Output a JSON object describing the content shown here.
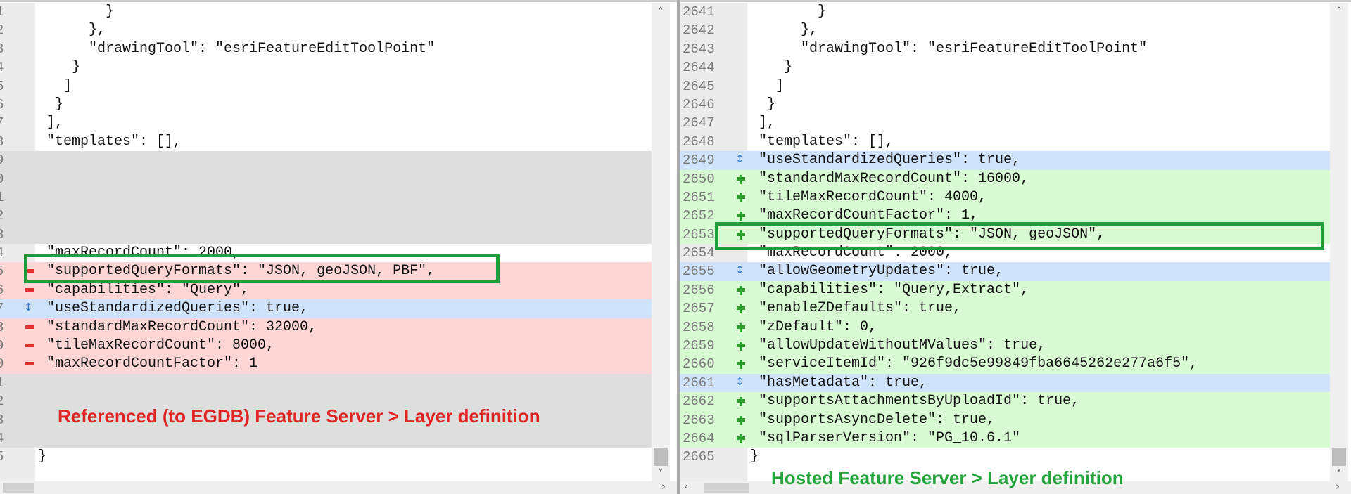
{
  "left_pane": {
    "caption": "Referenced (to EGDB) Feature Server > Layer definition",
    "lines": [
      {
        "num": "1",
        "type": "same",
        "marker": "",
        "text": "        }"
      },
      {
        "num": "2",
        "type": "same",
        "marker": "",
        "text": "      },"
      },
      {
        "num": "3",
        "type": "same",
        "marker": "",
        "text": "      \"drawingTool\": \"esriFeatureEditToolPoint\""
      },
      {
        "num": "4",
        "type": "same",
        "marker": "",
        "text": "    }"
      },
      {
        "num": "5",
        "type": "same",
        "marker": "",
        "text": "   ]"
      },
      {
        "num": "6",
        "type": "same",
        "marker": "",
        "text": "  }"
      },
      {
        "num": "7",
        "type": "same",
        "marker": "",
        "text": " ],"
      },
      {
        "num": "8",
        "type": "same",
        "marker": "",
        "text": " \"templates\": [],"
      },
      {
        "num": "9",
        "type": "gap",
        "marker": "",
        "text": ""
      },
      {
        "num": "0",
        "type": "gap",
        "marker": "",
        "text": ""
      },
      {
        "num": "1",
        "type": "gap",
        "marker": "",
        "text": ""
      },
      {
        "num": "2",
        "type": "gap",
        "marker": "",
        "text": ""
      },
      {
        "num": "3",
        "type": "gap",
        "marker": "",
        "text": ""
      },
      {
        "num": "4",
        "type": "same",
        "marker": "",
        "text": " \"maxRecordCount\": 2000,"
      },
      {
        "num": "5",
        "type": "del",
        "marker": "del",
        "text": " \"supportedQueryFormats\": \"JSON, geoJSON, PBF\","
      },
      {
        "num": "6",
        "type": "del",
        "marker": "del",
        "text": " \"capabilities\": \"Query\","
      },
      {
        "num": "7",
        "type": "chg",
        "marker": "chg",
        "text": " \"useStandardizedQueries\": true,"
      },
      {
        "num": "8",
        "type": "del",
        "marker": "del",
        "text": " \"standardMaxRecordCount\": 32000,"
      },
      {
        "num": "9",
        "type": "del",
        "marker": "del",
        "text": " \"tileMaxRecordCount\": 8000,"
      },
      {
        "num": "0",
        "type": "del",
        "marker": "del",
        "text": " \"maxRecordCountFactor\": 1"
      },
      {
        "num": "1",
        "type": "gap",
        "marker": "",
        "text": ""
      },
      {
        "num": "2",
        "type": "gap",
        "marker": "",
        "text": ""
      },
      {
        "num": "3",
        "type": "gap",
        "marker": "",
        "text": ""
      },
      {
        "num": "4",
        "type": "gap",
        "marker": "",
        "text": ""
      },
      {
        "num": "5",
        "type": "same",
        "marker": "",
        "text": "}"
      }
    ]
  },
  "right_pane": {
    "caption": "Hosted Feature Server > Layer definition",
    "lines": [
      {
        "num": "2641",
        "type": "same",
        "marker": "",
        "text": "        }"
      },
      {
        "num": "2642",
        "type": "same",
        "marker": "",
        "text": "      },"
      },
      {
        "num": "2643",
        "type": "same",
        "marker": "",
        "text": "      \"drawingTool\": \"esriFeatureEditToolPoint\""
      },
      {
        "num": "2644",
        "type": "same",
        "marker": "",
        "text": "    }"
      },
      {
        "num": "2645",
        "type": "same",
        "marker": "",
        "text": "   ]"
      },
      {
        "num": "2646",
        "type": "same",
        "marker": "",
        "text": "  }"
      },
      {
        "num": "2647",
        "type": "same",
        "marker": "",
        "text": " ],"
      },
      {
        "num": "2648",
        "type": "same",
        "marker": "",
        "text": " \"templates\": [],"
      },
      {
        "num": "2649",
        "type": "chg",
        "marker": "chg",
        "text": " \"useStandardizedQueries\": true,"
      },
      {
        "num": "2650",
        "type": "add",
        "marker": "add",
        "text": " \"standardMaxRecordCount\": 16000,"
      },
      {
        "num": "2651",
        "type": "add",
        "marker": "add",
        "text": " \"tileMaxRecordCount\": 4000,"
      },
      {
        "num": "2652",
        "type": "add",
        "marker": "add",
        "text": " \"maxRecordCountFactor\": 1,"
      },
      {
        "num": "2653",
        "type": "add",
        "marker": "add",
        "text": " \"supportedQueryFormats\": \"JSON, geoJSON\","
      },
      {
        "num": "2654",
        "type": "same",
        "marker": "",
        "text": " \"maxRecordCount\": 2000,"
      },
      {
        "num": "2655",
        "type": "chg",
        "marker": "chg",
        "text": " \"allowGeometryUpdates\": true,"
      },
      {
        "num": "2656",
        "type": "add",
        "marker": "add",
        "text": " \"capabilities\": \"Query,Extract\","
      },
      {
        "num": "2657",
        "type": "add",
        "marker": "add",
        "text": " \"enableZDefaults\": true,"
      },
      {
        "num": "2658",
        "type": "add",
        "marker": "add",
        "text": " \"zDefault\": 0,"
      },
      {
        "num": "2659",
        "type": "add",
        "marker": "add",
        "text": " \"allowUpdateWithoutMValues\": true,"
      },
      {
        "num": "2660",
        "type": "add",
        "marker": "add",
        "text": " \"serviceItemId\": \"926f9dc5e99849fba6645262e277a6f5\","
      },
      {
        "num": "2661",
        "type": "chg",
        "marker": "chg",
        "text": " \"hasMetadata\": true,"
      },
      {
        "num": "2662",
        "type": "add",
        "marker": "add",
        "text": " \"supportsAttachmentsByUploadId\": true,"
      },
      {
        "num": "2663",
        "type": "add",
        "marker": "add",
        "text": " \"supportsAsyncDelete\": true,"
      },
      {
        "num": "2664",
        "type": "add",
        "marker": "add",
        "text": " \"sqlParserVersion\": \"PG_10.6.1\""
      },
      {
        "num": "2665",
        "type": "same",
        "marker": "",
        "text": "}"
      }
    ]
  },
  "colors": {
    "deleted": "#ffd6d6",
    "added": "#d9fbd4",
    "changed": "#cfe4fb",
    "gap": "#dedede",
    "highlight_box": "#1f9e3a",
    "left_caption": "#e02525",
    "right_caption": "#23a53c"
  },
  "icons": {
    "deleted_marker": "minus-icon",
    "added_marker": "plus-icon",
    "changed_marker": "up-down-arrow-icon",
    "scroll_up": "chevron-up-icon",
    "scroll_down": "chevron-down-icon",
    "scroll_left": "chevron-left-icon",
    "scroll_right": "chevron-right-icon"
  },
  "scroll_arrows": {
    "up": "˄",
    "down": "˅",
    "left": "‹",
    "right": "›"
  }
}
